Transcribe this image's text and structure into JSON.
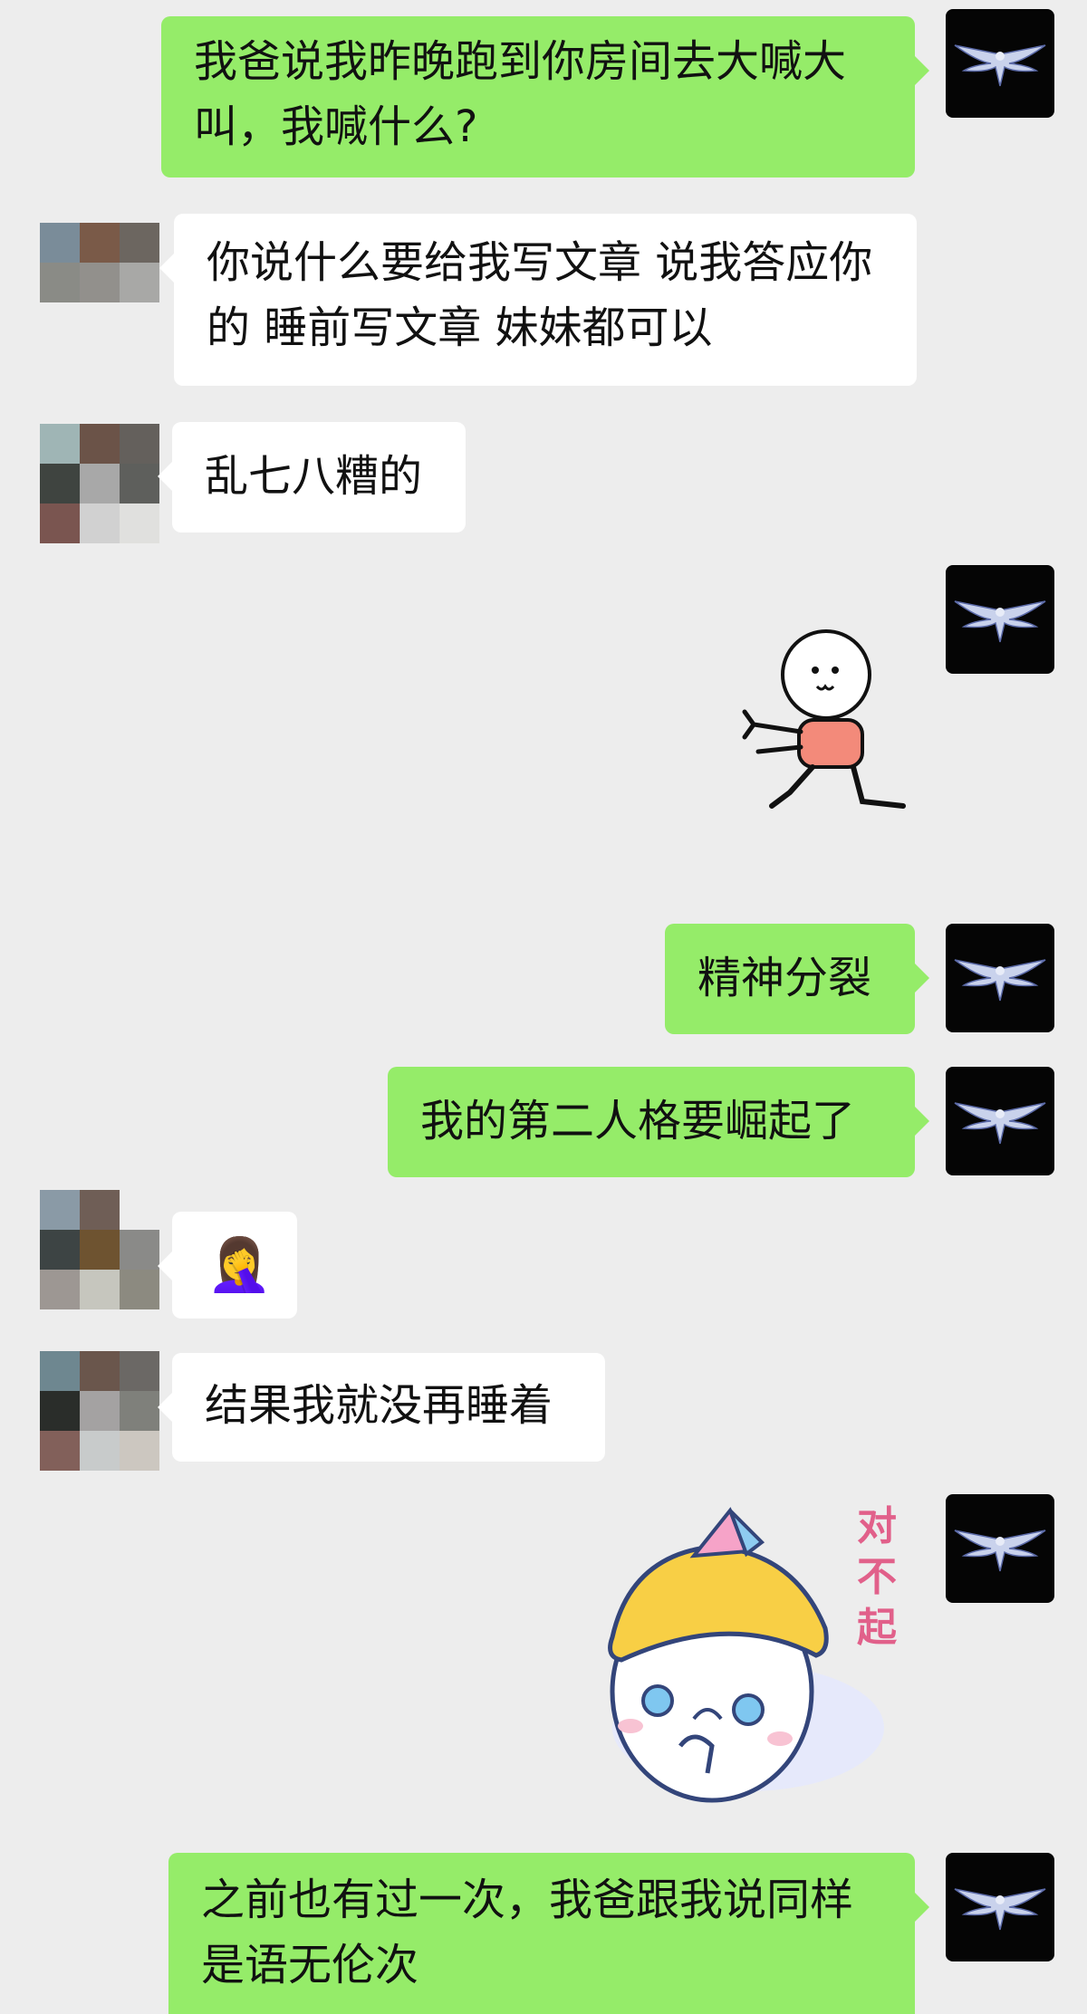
{
  "colors": {
    "background": "#ededed",
    "my_bubble": "#95ec69",
    "other_bubble": "#ffffff",
    "my_avatar_bg": "#050505"
  },
  "messages": [
    {
      "side": "me",
      "type": "text",
      "text": "我爸说我昨晚跑到你房间去大喊大叫，我喊什么?"
    },
    {
      "side": "other",
      "type": "text",
      "text": "你说什么要给我写文章 说我答应你的 睡前写文章 妹妹都可以"
    },
    {
      "side": "other",
      "type": "text",
      "text": "乱七八糟的"
    },
    {
      "side": "me",
      "type": "sticker",
      "icon": "stickman-crawling-sticker"
    },
    {
      "side": "me",
      "type": "text",
      "text": "精神分裂"
    },
    {
      "side": "me",
      "type": "text",
      "text": "我的第二人格要崛起了"
    },
    {
      "side": "other",
      "type": "emoji",
      "text": "🤦‍♀️",
      "icon": "facepalm-emoji"
    },
    {
      "side": "other",
      "type": "text",
      "text": "结果我就没再睡着"
    },
    {
      "side": "me",
      "type": "sticker",
      "icon": "sorry-cat-sticker",
      "caption": "对不起"
    },
    {
      "side": "me",
      "type": "text",
      "text": "之前也有过一次，我爸跟我说同样是语无伦次"
    }
  ],
  "avatars": {
    "me": "eagle-logo-icon",
    "other": "pixelated-avatar"
  }
}
